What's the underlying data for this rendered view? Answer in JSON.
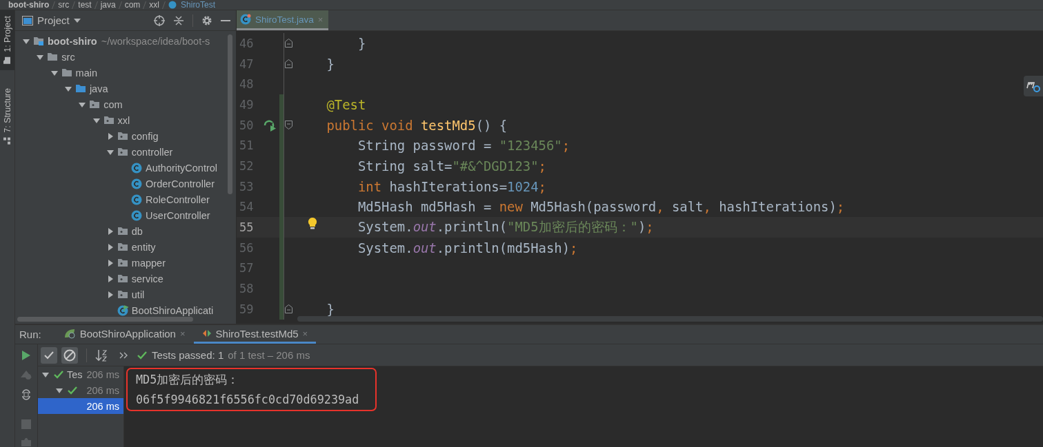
{
  "breadcrumbs": [
    "boot-shiro",
    "src",
    "test",
    "java",
    "com",
    "xxl",
    "ShiroTest"
  ],
  "tool_strip": [
    {
      "label": "1: Project",
      "selected": true
    },
    {
      "label": "7: Structure",
      "selected": false
    }
  ],
  "project_panel": {
    "title": "Project",
    "tree": [
      {
        "name": "boot-shiro",
        "kind": "module",
        "path": "~/workspace/idea/boot-s",
        "expanded": true,
        "children": [
          {
            "name": "src",
            "kind": "folder",
            "expanded": true,
            "children": [
              {
                "name": "main",
                "kind": "folder",
                "expanded": true,
                "children": [
                  {
                    "name": "java",
                    "kind": "source",
                    "expanded": true,
                    "children": [
                      {
                        "name": "com",
                        "kind": "package",
                        "expanded": true,
                        "children": [
                          {
                            "name": "xxl",
                            "kind": "package",
                            "expanded": true,
                            "children": [
                              {
                                "name": "config",
                                "kind": "package",
                                "expanded": false
                              },
                              {
                                "name": "controller",
                                "kind": "package",
                                "expanded": true,
                                "children": [
                                  {
                                    "name": "AuthorityControl",
                                    "kind": "class"
                                  },
                                  {
                                    "name": "OrderController",
                                    "kind": "class"
                                  },
                                  {
                                    "name": "RoleController",
                                    "kind": "class"
                                  },
                                  {
                                    "name": "UserController",
                                    "kind": "class"
                                  }
                                ]
                              },
                              {
                                "name": "db",
                                "kind": "package",
                                "expanded": false
                              },
                              {
                                "name": "entity",
                                "kind": "package",
                                "expanded": false
                              },
                              {
                                "name": "mapper",
                                "kind": "package",
                                "expanded": false
                              },
                              {
                                "name": "service",
                                "kind": "package",
                                "expanded": false
                              },
                              {
                                "name": "util",
                                "kind": "package",
                                "expanded": false
                              },
                              {
                                "name": "BootShiroApplicati",
                                "kind": "app"
                              }
                            ]
                          }
                        ]
                      }
                    ]
                  }
                ]
              }
            ]
          }
        ]
      }
    ]
  },
  "editor": {
    "tabs": [
      {
        "label": "ShiroTest.java",
        "close": "×",
        "selected": true
      }
    ],
    "lines": [
      {
        "number": "46",
        "current": false,
        "changed": false,
        "fold": {
          "kind": "end"
        },
        "tokens": [
          {
            "text": "        }",
            "kind": "plain"
          }
        ]
      },
      {
        "number": "47",
        "current": false,
        "changed": false,
        "fold": {
          "kind": "end"
        },
        "tokens": [
          {
            "text": "    }",
            "kind": "plain"
          }
        ]
      },
      {
        "number": "48",
        "current": false,
        "changed": false
      },
      {
        "number": "49",
        "current": false,
        "changed": true,
        "tokens": [
          {
            "text": "    @Test",
            "kind": "annotation"
          }
        ]
      },
      {
        "number": "50",
        "current": false,
        "changed": true,
        "fold": {
          "kind": "start"
        },
        "marker": {
          "kind": "run"
        },
        "tokens": [
          {
            "text": "    public",
            "kind": "keyword"
          },
          {
            "text": " void",
            "kind": "keyword"
          },
          {
            "text": " testMd5",
            "kind": "method"
          },
          {
            "text": "() {",
            "kind": "plain"
          }
        ]
      },
      {
        "number": "51",
        "current": false,
        "changed": true,
        "tokens": [
          {
            "text": "        String password = ",
            "kind": "plain"
          },
          {
            "text": "\"123456\"",
            "kind": "string"
          },
          {
            "text": ";",
            "kind": "keyword"
          }
        ]
      },
      {
        "number": "52",
        "current": false,
        "changed": true,
        "tokens": [
          {
            "text": "        String salt=",
            "kind": "plain"
          },
          {
            "text": "\"#&^DGD123\"",
            "kind": "string"
          },
          {
            "text": ";",
            "kind": "keyword"
          }
        ]
      },
      {
        "number": "53",
        "current": false,
        "changed": true,
        "tokens": [
          {
            "text": "        int",
            "kind": "keyword"
          },
          {
            "text": " hashIterations=",
            "kind": "plain"
          },
          {
            "text": "1024",
            "kind": "number"
          },
          {
            "text": ";",
            "kind": "keyword"
          }
        ]
      },
      {
        "number": "54",
        "current": false,
        "changed": true,
        "tokens": [
          {
            "text": "        Md5Hash md5Hash = ",
            "kind": "plain"
          },
          {
            "text": "new",
            "kind": "keyword"
          },
          {
            "text": " Md5Hash(password",
            "kind": "plain"
          },
          {
            "text": ",",
            "kind": "keyword"
          },
          {
            "text": " salt",
            "kind": "plain"
          },
          {
            "text": ",",
            "kind": "keyword"
          },
          {
            "text": " hashIterations)",
            "kind": "plain"
          },
          {
            "text": ";",
            "kind": "keyword"
          }
        ]
      },
      {
        "number": "55",
        "current": true,
        "changed": true,
        "marker": {
          "kind": "bulb"
        },
        "tokens": [
          {
            "text": "        System.",
            "kind": "plain"
          },
          {
            "text": "out",
            "kind": "field"
          },
          {
            "text": ".println(",
            "kind": "plain"
          },
          {
            "text": "\"MD5加密后的密码：\"",
            "kind": "string"
          },
          {
            "text": ")",
            "kind": "plain"
          },
          {
            "text": ";",
            "kind": "keyword"
          }
        ]
      },
      {
        "number": "56",
        "current": false,
        "changed": true,
        "tokens": [
          {
            "text": "        System.",
            "kind": "plain"
          },
          {
            "text": "out",
            "kind": "field"
          },
          {
            "text": ".println(md5Hash)",
            "kind": "plain"
          },
          {
            "text": ";",
            "kind": "keyword"
          }
        ]
      },
      {
        "number": "57",
        "current": false,
        "changed": true
      },
      {
        "number": "58",
        "current": false,
        "changed": true
      },
      {
        "number": "59",
        "current": false,
        "changed": true,
        "fold": {
          "kind": "end"
        },
        "tokens": [
          {
            "text": "    }",
            "kind": "plain"
          }
        ]
      }
    ]
  },
  "run_panel": {
    "label": "Run:",
    "tabs": [
      {
        "label": "BootShiroApplication",
        "close": "×",
        "kind": "app",
        "selected": false
      },
      {
        "label": "ShiroTest.testMd5",
        "close": "×",
        "kind": "test",
        "selected": true
      }
    ],
    "toggles": [
      {
        "kind": "passed",
        "on": true
      },
      {
        "kind": "ignored",
        "on": true
      }
    ],
    "status_title": "Tests passed: 1",
    "status_detail": "of 1 test – 206 ms",
    "tests": [
      {
        "name": "Tes",
        "time": "206 ms",
        "passed": true,
        "expanded": true,
        "selected": false,
        "children": [
          {
            "time": "206 ms",
            "passed": true,
            "expanded": true,
            "selected": false,
            "children": [
              {
                "time": "206 ms",
                "selected": true
              }
            ]
          }
        ]
      }
    ],
    "console": {
      "highlighted": true,
      "lines": [
        "MD5加密后的密码：",
        "06f5f9946821f6556fc0cd70d69239ad"
      ]
    }
  }
}
